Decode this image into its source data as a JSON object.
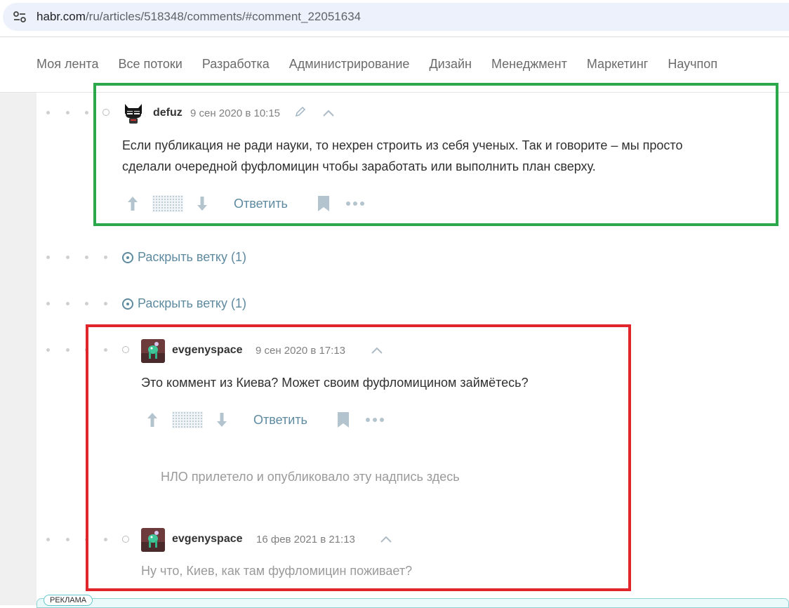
{
  "browser": {
    "url_host": "habr.com",
    "url_path": "/ru/articles/518348/comments/#comment_22051634"
  },
  "nav": {
    "items": [
      {
        "label": "Моя лента"
      },
      {
        "label": "Все потоки"
      },
      {
        "label": "Разработка"
      },
      {
        "label": "Администрирование"
      },
      {
        "label": "Дизайн"
      },
      {
        "label": "Менеджмент"
      },
      {
        "label": "Маркетинг"
      },
      {
        "label": "Научпоп"
      }
    ]
  },
  "comments": [
    {
      "username": "defuz",
      "date": "9 сен 2020 в 10:15",
      "text_line1": "Если публикация не ради науки, то нехрен строить из себя ученых. Так и говорите – мы просто",
      "text_line2": "сделали очередной фуфломицин чтобы заработать или выполнить план сверху.",
      "reply_label": "Ответить",
      "avatar_icon": "robot-avatar",
      "edited_icon": "pencil-icon"
    },
    {
      "username": "evgenyspace",
      "date": "9 сен 2020 в 17:13",
      "text": "Это коммент из Киева? Может своим фуфломицином займётесь?",
      "reply_label": "Ответить",
      "avatar_icon": "green-creature-avatar"
    },
    {
      "username": "evgenyspace",
      "date": "16 фев 2021 в 21:13",
      "text": "Ну что, Киев, как там фуфломицин поживает?",
      "avatar_icon": "green-creature-avatar"
    }
  ],
  "expand_branches": [
    {
      "label": "Раскрыть ветку (1)"
    },
    {
      "label": "Раскрыть ветку (1)"
    }
  ],
  "ufo_notice": "НЛО прилетело и опубликовало эту надпись здесь",
  "ad": {
    "label": "РЕКЛАМА"
  },
  "colors": {
    "accent_link": "#5e8aa0",
    "highlight_green": "#2aa84a",
    "highlight_red": "#e0252b"
  }
}
